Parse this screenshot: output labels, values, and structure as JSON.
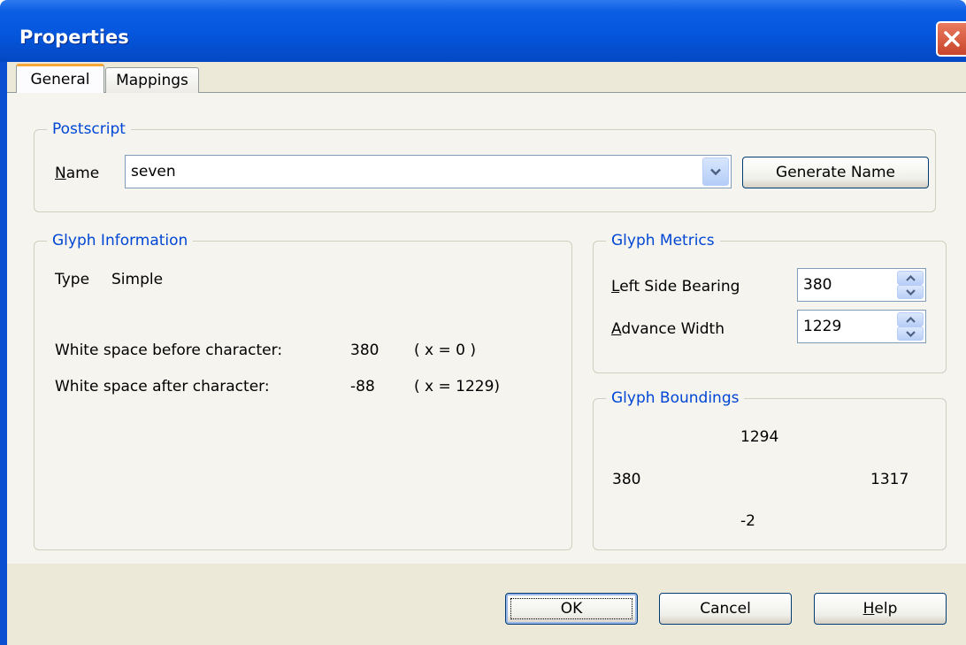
{
  "window": {
    "title": "Properties",
    "close_icon": "close-icon"
  },
  "tabs": [
    {
      "label": "General",
      "selected": true
    },
    {
      "label": "Mappings",
      "selected": false
    }
  ],
  "postscript": {
    "legend": "Postscript",
    "name_label_first": "N",
    "name_label_rest": "ame",
    "name_value": "seven",
    "generate_button": "Generate Name"
  },
  "glyph_info": {
    "legend": "Glyph Information",
    "type_label": "Type",
    "type_value": "Simple",
    "before_label": "White space before character:",
    "before_value": "380",
    "before_x": "( x = 0 )",
    "after_label": "White space after character:",
    "after_value": "-88",
    "after_x": "( x = 1229)"
  },
  "glyph_metrics": {
    "legend": "Glyph Metrics",
    "lsb_label_first": "L",
    "lsb_label_rest": "eft Side Bearing",
    "lsb_value": "380",
    "aw_label_first": "A",
    "aw_label_rest": "dvance Width",
    "aw_value": "1229"
  },
  "glyph_boundings": {
    "legend": "Glyph Boundings",
    "top": "1294",
    "left": "380",
    "right": "1317",
    "bottom": "-2"
  },
  "buttons": {
    "ok": "OK",
    "cancel": "Cancel",
    "help_first": "H",
    "help_rest": "elp"
  }
}
